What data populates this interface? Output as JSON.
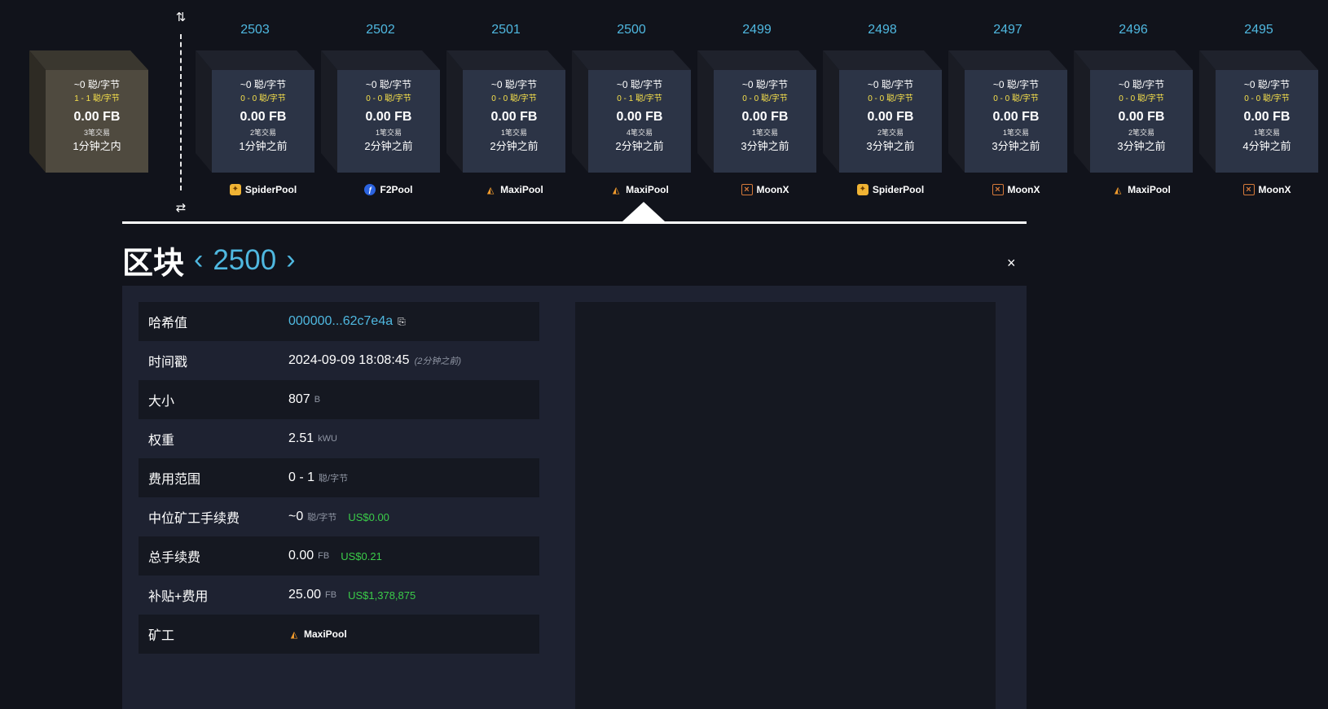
{
  "mempool": {
    "fee": "~0 聪/字节",
    "range": "1 - 1 聪/字节",
    "total": "0.00 FB",
    "txs": "3笔交易",
    "time": "1分钟之内"
  },
  "chain_arrows": {
    "top": "⇅",
    "bottom": "⇄"
  },
  "blocks": [
    {
      "height": "2503",
      "fee": "~0 聪/字节",
      "range": "0 - 0 聪/字节",
      "total": "0.00 FB",
      "txs": "2笔交易",
      "time": "1分钟之前",
      "pool": "SpiderPool",
      "pool_icon": "spiderpool-icon"
    },
    {
      "height": "2502",
      "fee": "~0 聪/字节",
      "range": "0 - 0 聪/字节",
      "total": "0.00 FB",
      "txs": "1笔交易",
      "time": "2分钟之前",
      "pool": "F2Pool",
      "pool_icon": "f2pool-icon"
    },
    {
      "height": "2501",
      "fee": "~0 聪/字节",
      "range": "0 - 0 聪/字节",
      "total": "0.00 FB",
      "txs": "1笔交易",
      "time": "2分钟之前",
      "pool": "MaxiPool",
      "pool_icon": "maxipool-icon"
    },
    {
      "height": "2500",
      "fee": "~0 聪/字节",
      "range": "0 - 1 聪/字节",
      "total": "0.00 FB",
      "txs": "4笔交易",
      "time": "2分钟之前",
      "pool": "MaxiPool",
      "pool_icon": "maxipool-icon"
    },
    {
      "height": "2499",
      "fee": "~0 聪/字节",
      "range": "0 - 0 聪/字节",
      "total": "0.00 FB",
      "txs": "1笔交易",
      "time": "3分钟之前",
      "pool": "MoonX",
      "pool_icon": "moonx-icon"
    },
    {
      "height": "2498",
      "fee": "~0 聪/字节",
      "range": "0 - 0 聪/字节",
      "total": "0.00 FB",
      "txs": "2笔交易",
      "time": "3分钟之前",
      "pool": "SpiderPool",
      "pool_icon": "spiderpool-icon"
    },
    {
      "height": "2497",
      "fee": "~0 聪/字节",
      "range": "0 - 0 聪/字节",
      "total": "0.00 FB",
      "txs": "1笔交易",
      "time": "3分钟之前",
      "pool": "MoonX",
      "pool_icon": "moonx-icon"
    },
    {
      "height": "2496",
      "fee": "~0 聪/字节",
      "range": "0 - 0 聪/字节",
      "total": "0.00 FB",
      "txs": "2笔交易",
      "time": "3分钟之前",
      "pool": "MaxiPool",
      "pool_icon": "maxipool-icon"
    },
    {
      "height": "2495",
      "fee": "~0 聪/字节",
      "range": "0 - 0 聪/字节",
      "total": "0.00 FB",
      "txs": "1笔交易",
      "time": "4分钟之前",
      "pool": "MoonX",
      "pool_icon": "moonx-icon"
    }
  ],
  "detail": {
    "title": "区块",
    "height": "2500",
    "prev_arrow": "‹",
    "next_arrow": "›",
    "close": "×",
    "rows": {
      "hash": {
        "label": "哈希值",
        "value": "000000...62c7e4a"
      },
      "timestamp": {
        "label": "时间戳",
        "value": "2024-09-09 18:08:45",
        "ago": "(2分钟之前)"
      },
      "size": {
        "label": "大小",
        "value": "807",
        "unit": "B"
      },
      "weight": {
        "label": "权重",
        "value": "2.51",
        "unit": "kWU"
      },
      "fee_range": {
        "label": "费用范围",
        "value": "0 - 1",
        "unit": "聪/字节"
      },
      "median_fee": {
        "label": "中位矿工手续费",
        "value": "~0",
        "unit": "聪/字节",
        "usd": "US$0.00"
      },
      "total_fees": {
        "label": "总手续费",
        "value": "0.00",
        "unit": "FB",
        "usd": "US$0.21"
      },
      "subsidy": {
        "label": "补贴+费用",
        "value": "25.00",
        "unit": "FB",
        "usd": "US$1,378,875"
      },
      "miner": {
        "label": "矿工",
        "value": "MaxiPool"
      }
    }
  },
  "colors": {
    "background": "#11131b",
    "accent": "#4fb8e0",
    "fee_range": "#f6e04b",
    "usd": "#3bcc49",
    "panel": "#1e2231"
  }
}
